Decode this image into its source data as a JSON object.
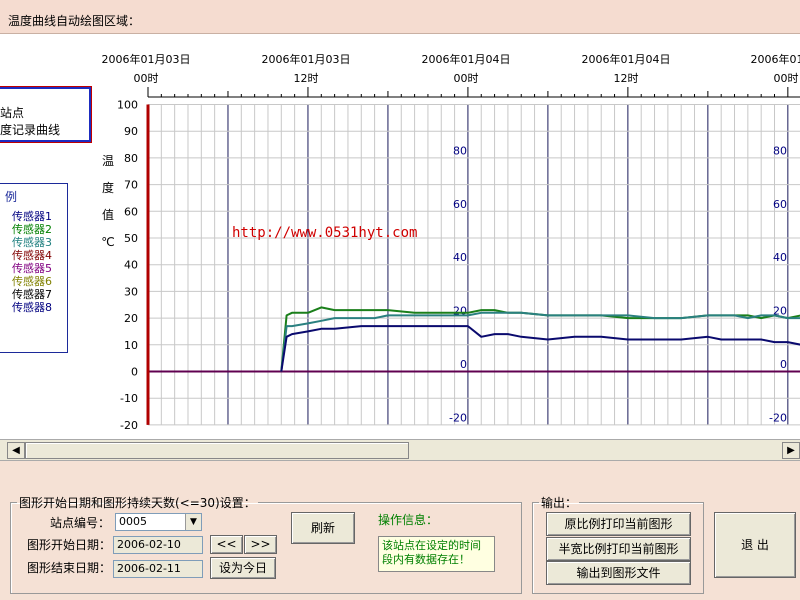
{
  "window": {
    "title": "温度曲线自动绘图区域："
  },
  "plot": {
    "date_labels": [
      "2006年01月03日",
      "2006年01月03日",
      "2006年01月04日",
      "2006年01月04日",
      "2006年01月0"
    ],
    "hour_labels": [
      "00时",
      "12时",
      "00时",
      "12时",
      "00时"
    ],
    "y_axis_ticks": [
      "100",
      "90",
      "80",
      "70",
      "60",
      "50",
      "40",
      "30",
      "20",
      "10",
      "0",
      "-10",
      "-20"
    ],
    "y_axis_title": [
      "温",
      "度",
      "值",
      "℃"
    ],
    "inner_scale_ticks": [
      "80",
      "60",
      "40",
      "20",
      "0",
      "-20"
    ],
    "watermark": "http://www.0531hyt.com"
  },
  "station_box": {
    "line1": "站点",
    "line2": "度记录曲线"
  },
  "legend": {
    "title": "例",
    "items": [
      {
        "label": "传感器1",
        "color": "#000080"
      },
      {
        "label": "传感器2",
        "color": "#008000"
      },
      {
        "label": "传感器3",
        "color": "#1f7f7f"
      },
      {
        "label": "传感器4",
        "color": "#800000"
      },
      {
        "label": "传感器5",
        "color": "#800080"
      },
      {
        "label": "传感器6",
        "color": "#808000"
      },
      {
        "label": "传感器7",
        "color": "#000000"
      },
      {
        "label": "传感器8",
        "color": "#000080"
      }
    ]
  },
  "settings": {
    "group_label": "图形开始日期和图形持续天数(<=30)设置：",
    "station_label": "站点编号：",
    "station_value": "0005",
    "start_label": "图形开始日期：",
    "start_value": "2006-02-10",
    "end_label": "图形结束日期：",
    "end_value": "2006-02-11",
    "prev_label": "<<",
    "next_label": ">>",
    "today_label": "设为今日",
    "refresh_label": "刷新",
    "info_title": "操作信息：",
    "info_text": "该站点在设定的时间段内有数据存在！"
  },
  "output": {
    "group_label": "输出：",
    "print_full": "原比例打印当前图形",
    "print_half": "半宽比例打印当前图形",
    "export_file": "输出到图形文件",
    "exit_label": "退 出"
  },
  "chart_data": {
    "type": "line",
    "ylim": [
      -20,
      100
    ],
    "inner_ylim": [
      -20,
      80
    ],
    "x_unit": "hours since 2006-01-03 00:00",
    "series": [
      {
        "name": "传感器2",
        "color": "#1a7f1a",
        "x": [
          10.0,
          10.4,
          10.8,
          12.0,
          13.0,
          14.0,
          16.0,
          17.0,
          18.0,
          20.0,
          22.0,
          24.0,
          25.0,
          26.0,
          27.0,
          28.0,
          30.0,
          32.0,
          34.0,
          36.0,
          38.0,
          40.0,
          42.0,
          43.0,
          44.0,
          45.0,
          46.0,
          47.0,
          48.0,
          49.0,
          49.6
        ],
        "y": [
          0,
          21,
          22,
          22,
          24,
          23,
          23,
          23,
          23,
          22,
          22,
          22,
          23,
          23,
          22,
          22,
          21,
          21,
          21,
          20,
          20,
          20,
          21,
          21,
          21,
          21,
          20,
          21,
          20,
          21,
          19
        ]
      },
      {
        "name": "传感器3",
        "color": "#2a8080",
        "x": [
          10.0,
          10.4,
          10.8,
          12.0,
          13.0,
          14.0,
          16.0,
          17.0,
          18.0,
          20.0,
          22.0,
          24.0,
          25.0,
          26.0,
          27.0,
          28.0,
          30.0,
          32.0,
          34.0,
          36.0,
          38.0,
          40.0,
          42.0,
          43.0,
          44.0,
          45.0,
          46.0,
          47.0,
          48.0,
          49.0,
          49.6
        ],
        "y": [
          0,
          17,
          17,
          18,
          19,
          20,
          20,
          20,
          21,
          21,
          21,
          21,
          22,
          22,
          22,
          22,
          21,
          21,
          21,
          21,
          20,
          20,
          21,
          21,
          21,
          20,
          21,
          21,
          20,
          20,
          20
        ]
      },
      {
        "name": "传感器1",
        "color": "#0a0a6e",
        "x": [
          10.0,
          10.4,
          10.8,
          12.0,
          13.0,
          14.0,
          16.0,
          17.0,
          18.0,
          20.0,
          22.0,
          24.0,
          25.0,
          26.0,
          27.0,
          28.0,
          30.0,
          32.0,
          34.0,
          36.0,
          38.0,
          40.0,
          42.0,
          43.0,
          44.0,
          45.0,
          46.0,
          47.0,
          48.0,
          49.0,
          49.6
        ],
        "y": [
          0,
          13,
          14,
          15,
          16,
          16,
          17,
          17,
          17,
          17,
          17,
          17,
          13,
          14,
          14,
          13,
          12,
          13,
          13,
          12,
          12,
          12,
          13,
          12,
          12,
          12,
          12,
          11,
          11,
          10,
          10
        ]
      }
    ]
  }
}
